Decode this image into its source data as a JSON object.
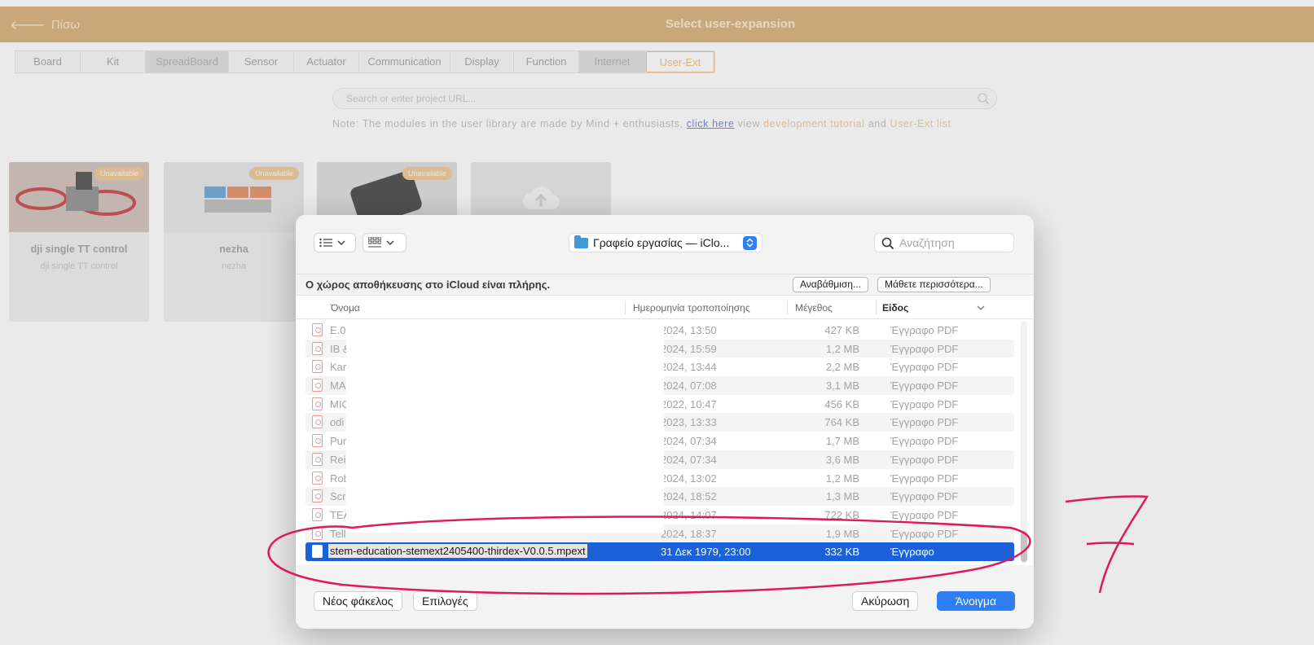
{
  "app": {
    "back_label": "Πίσω",
    "title": "Select user-expansion",
    "tabs": [
      {
        "label": "Board"
      },
      {
        "label": "Kit"
      },
      {
        "label": "SpreadBoard"
      },
      {
        "label": "Sensor"
      },
      {
        "label": "Actuator"
      },
      {
        "label": "Communication"
      },
      {
        "label": "Display"
      },
      {
        "label": "Function"
      },
      {
        "label": "Internet"
      },
      {
        "label": "User-Ext"
      }
    ],
    "search_placeholder": "Search or enter project URL...",
    "note": {
      "prefix": "Note: The modules in the user library are made by Mind + enthusiasts, ",
      "link": "click here",
      "middle": " view ",
      "tutorial": "development tutorial",
      "and": " and ",
      "list": "User-Ext list"
    },
    "cards": [
      {
        "badge": "Unavailable",
        "name": "dji single TT control",
        "sub": "dji single TT control"
      },
      {
        "badge": "Unavailable",
        "name": "nezha",
        "sub": "nezha"
      },
      {
        "badge": "Unavailable",
        "name": "",
        "sub": ""
      }
    ]
  },
  "dialog": {
    "location": "Γραφείο εργασίας — iClo...",
    "search_placeholder": "Αναζήτηση",
    "icloud_message": "Ο χώρος αποθήκευσης στο iCloud είναι πλήρης.",
    "upgrade_button": "Αναβάθμιση...",
    "learn_more_button": "Μάθετε περισσότερα...",
    "columns": {
      "name": "Όνομα",
      "date": "Ημερομηνία τροποποίησης",
      "size": "Μέγεθος",
      "kind": "Είδος"
    },
    "rows": [
      {
        "name": "E.0",
        "date": "2024, 13:50",
        "size": "427 KB",
        "kind": "Έγγραφο PDF"
      },
      {
        "name": "IB &",
        "date": "2024, 15:59",
        "size": "1,2 MB",
        "kind": "Έγγραφο PDF"
      },
      {
        "name": "Kar",
        "date": "2024, 13:44",
        "size": "2,2 MB",
        "kind": "Έγγραφο PDF"
      },
      {
        "name": "MA",
        "date": "2024, 07:08",
        "size": "3,1 MB",
        "kind": "Έγγραφο PDF"
      },
      {
        "name": "MIC",
        "date": "2022, 10:47",
        "size": "456 KB",
        "kind": "Έγγραφο PDF"
      },
      {
        "name": "odi",
        "date": "2023, 13:33",
        "size": "764 KB",
        "kind": "Έγγραφο PDF"
      },
      {
        "name": "Pur",
        "date": "2024, 07:34",
        "size": "1,7 MB",
        "kind": "Έγγραφο PDF"
      },
      {
        "name": "Rei",
        "date": "2024, 07:34",
        "size": "3,6 MB",
        "kind": "Έγγραφο PDF"
      },
      {
        "name": "Rob",
        "date": "2024, 13:02",
        "size": "1,2 MB",
        "kind": "Έγγραφο PDF"
      },
      {
        "name": "Scr",
        "date": "2024, 18:52",
        "size": "1,3 MB",
        "kind": "Έγγραφο PDF"
      },
      {
        "name": "TEA",
        "date": "2024, 14:07",
        "size": "722 KB",
        "kind": "Έγγραφο PDF"
      },
      {
        "name": "Tell",
        "date": "2024, 18:37",
        "size": "1,9 MB",
        "kind": "Έγγραφο PDF"
      }
    ],
    "selected_row": {
      "name": "stem-education-stemext2405400-thirdex-V0.0.5.mpext",
      "date": "31 Δεκ 1979, 23:00",
      "size": "332 KB",
      "kind": "Έγγραφο"
    },
    "new_folder_button": "Νέος φάκελος",
    "options_button": "Επιλογές",
    "cancel_button": "Ακύρωση",
    "open_button": "Άνοιγμα"
  },
  "colors": {
    "header": "#d4aa6e",
    "accent": "#e9b97a",
    "selection": "#1b62d9",
    "primary_button": "#2f7ff2",
    "annotation": "#e0195c"
  }
}
